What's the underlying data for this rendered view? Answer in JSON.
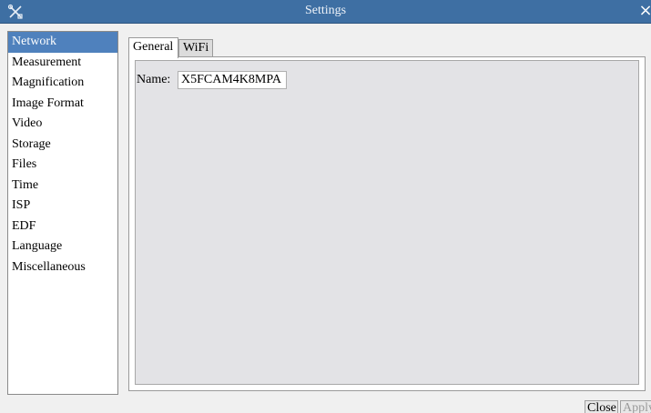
{
  "window": {
    "title": "Settings",
    "close_glyph": "×",
    "app_icon": "tools-icon"
  },
  "sidebar": {
    "items": [
      {
        "label": "Network",
        "selected": true
      },
      {
        "label": "Measurement"
      },
      {
        "label": "Magnification"
      },
      {
        "label": "Image Format"
      },
      {
        "label": "Video"
      },
      {
        "label": "Storage"
      },
      {
        "label": "Files"
      },
      {
        "label": "Time"
      },
      {
        "label": "ISP"
      },
      {
        "label": "EDF"
      },
      {
        "label": "Language"
      },
      {
        "label": "Miscellaneous"
      }
    ]
  },
  "tabs": [
    {
      "label": "General",
      "active": true
    },
    {
      "label": "WiFi",
      "active": false
    }
  ],
  "general": {
    "name_label": "Name:",
    "name_value": "X5FCAM4K8MPA"
  },
  "footer": {
    "close_label": "Close",
    "apply_label": "Apply"
  },
  "colors": {
    "titlebar": "#3e6fa3",
    "selection": "#4f81bd",
    "panel_bg": "#e3e3e6"
  }
}
